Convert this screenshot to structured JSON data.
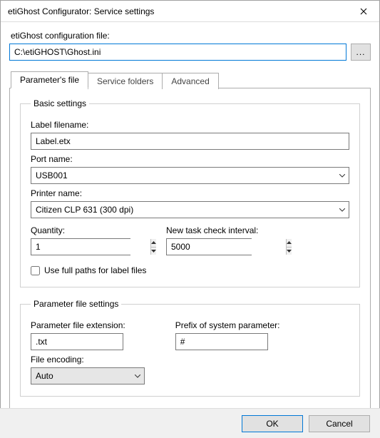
{
  "window": {
    "title": "etiGhost Configurator: Service settings"
  },
  "config_file": {
    "label": "etiGhost configuration file:",
    "value": "C:\\etiGHOST\\Ghost.ini",
    "browse": "..."
  },
  "tabs": {
    "items": [
      {
        "label": "Parameter's file",
        "active": true
      },
      {
        "label": "Service folders",
        "active": false
      },
      {
        "label": "Advanced",
        "active": false
      }
    ]
  },
  "basic": {
    "legend": "Basic settings",
    "label_filename": {
      "label": "Label filename:",
      "value": "Label.etx"
    },
    "port_name": {
      "label": "Port name:",
      "value": "USB001"
    },
    "printer_name": {
      "label": "Printer name:",
      "value": "Citizen CLP 631 (300 dpi)"
    },
    "quantity": {
      "label": "Quantity:",
      "value": "1"
    },
    "interval": {
      "label": "New task check interval:",
      "value": "5000"
    },
    "full_paths": {
      "label": "Use full paths for label files",
      "checked": false
    }
  },
  "paramfile": {
    "legend": "Parameter file settings",
    "extension": {
      "label": "Parameter file extension:",
      "value": ".txt"
    },
    "prefix": {
      "label": "Prefix of system parameter:",
      "value": "#"
    },
    "encoding": {
      "label": "File encoding:",
      "value": "Auto"
    }
  },
  "buttons": {
    "ok": "OK",
    "cancel": "Cancel"
  }
}
